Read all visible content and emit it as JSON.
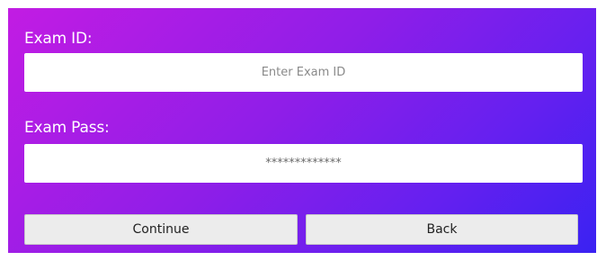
{
  "form": {
    "exam_id_label": "Exam ID:",
    "exam_id_placeholder": "Enter Exam ID",
    "exam_id_value": "",
    "exam_pass_label": "Exam Pass:",
    "exam_pass_value": "*************"
  },
  "buttons": {
    "continue_label": "Continue",
    "back_label": "Back"
  },
  "colors": {
    "gradient_start": "#c21ce3",
    "gradient_end": "#3a22f2",
    "label_text": "#ffffff",
    "button_bg": "#ececec"
  }
}
